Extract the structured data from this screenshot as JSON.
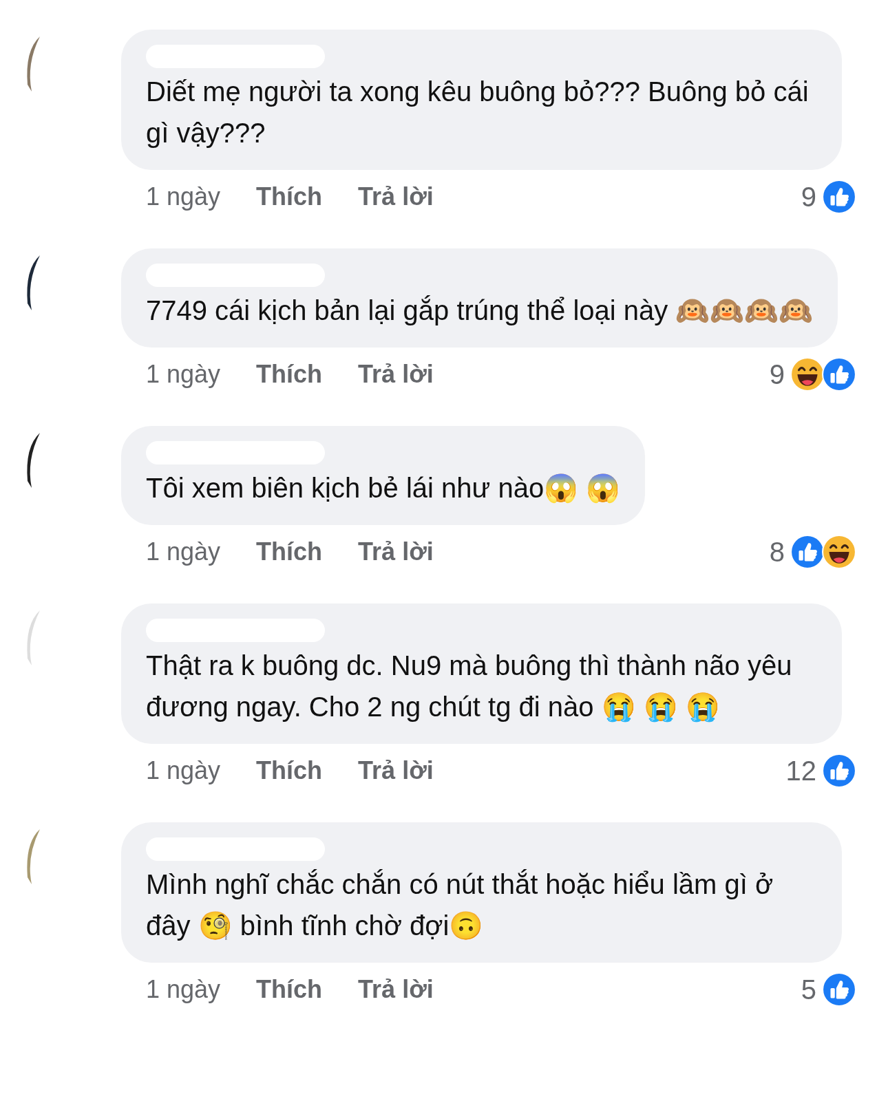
{
  "comments": [
    {
      "text": "Diết mẹ người ta xong kêu buông bỏ??? Buông bỏ cái gì vậy???",
      "time": "1 ngày",
      "like_label": "Thích",
      "reply_label": "Trả lời",
      "reaction_count": "9",
      "reactions": [
        {
          "kind": "like"
        }
      ]
    },
    {
      "text": "7749 cái kịch bản lại gắp trúng thể loại này 🙉🙉🙉🙉",
      "time": "1 ngày",
      "like_label": "Thích",
      "reply_label": "Trả lời",
      "reaction_count": "9",
      "reactions": [
        {
          "kind": "haha"
        },
        {
          "kind": "like"
        }
      ]
    },
    {
      "text": "Tôi xem biên kịch bẻ lái như nào😱 😱",
      "time": "1 ngày",
      "like_label": "Thích",
      "reply_label": "Trả lời",
      "reaction_count": "8",
      "reactions": [
        {
          "kind": "like"
        },
        {
          "kind": "haha"
        }
      ]
    },
    {
      "text": "Thật ra k buông dc. Nu9 mà buông thì thành não yêu đương  ngay. Cho 2 ng chút tg đi nào 😭 😭 😭",
      "time": "1 ngày",
      "like_label": "Thích",
      "reply_label": "Trả lời",
      "reaction_count": "12",
      "reactions": [
        {
          "kind": "like"
        }
      ]
    },
    {
      "text": "Mình nghĩ chắc chắn có nút thắt hoặc hiểu lầm gì ở đây 🧐 bình tĩnh chờ đợi🙃",
      "time": "1 ngày",
      "like_label": "Thích",
      "reply_label": "Trả lời",
      "reaction_count": "5",
      "reactions": [
        {
          "kind": "like"
        }
      ]
    }
  ]
}
